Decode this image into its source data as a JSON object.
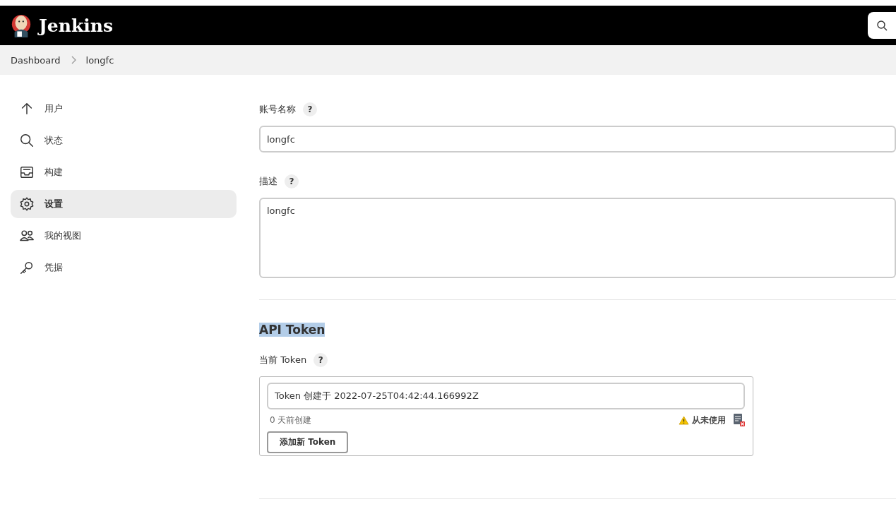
{
  "header": {
    "brand": "Jenkins"
  },
  "breadcrumbs": [
    {
      "label": "Dashboard"
    },
    {
      "label": "longfc"
    }
  ],
  "sidebar": {
    "items": [
      {
        "label": "用户",
        "kind": "up",
        "selected": false
      },
      {
        "label": "状态",
        "kind": "search",
        "selected": false
      },
      {
        "label": "构建",
        "kind": "inbox",
        "selected": false
      },
      {
        "label": "设置",
        "kind": "gear",
        "selected": true
      },
      {
        "label": "我的视图",
        "kind": "people",
        "selected": false
      },
      {
        "label": "凭据",
        "kind": "key",
        "selected": false
      }
    ]
  },
  "form": {
    "account_name": {
      "label": "账号名称",
      "help": "?",
      "value": "longfc"
    },
    "description": {
      "label": "描述",
      "help": "?",
      "value": "longfc"
    }
  },
  "api_token": {
    "title": "API Token",
    "highlighted": true,
    "current_label": "当前 Token",
    "help": "?",
    "token": {
      "value": "Token 创建于 2022-07-25T04:42:44.166992Z",
      "age": "0 天前创建",
      "usage": "从未使用"
    },
    "add_button": "添加新 Token"
  }
}
